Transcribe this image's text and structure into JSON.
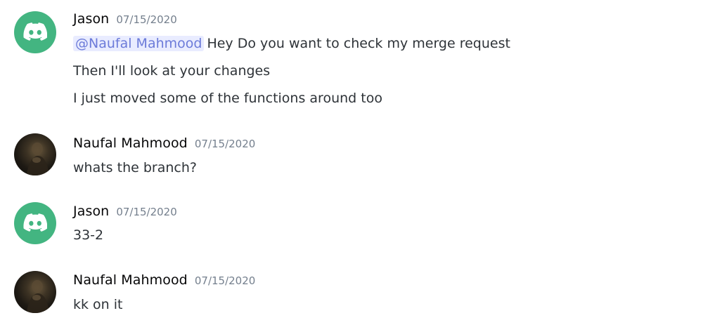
{
  "messages": [
    {
      "author": "Jason",
      "timestamp": "07/15/2020",
      "avatar": "discord-default-avatar",
      "avatar_color": "#43b581",
      "lines": [
        {
          "mention": "@Naufal Mahmood",
          "text": "Hey Do you want to check my merge request"
        },
        {
          "text": "Then I'll look at your changes"
        },
        {
          "text": "I just moved some of the functions around too"
        }
      ]
    },
    {
      "author": "Naufal Mahmood",
      "timestamp": "07/15/2020",
      "avatar": "user-photo-avatar",
      "lines": [
        {
          "text": "whats the branch?"
        }
      ]
    },
    {
      "author": "Jason",
      "timestamp": "07/15/2020",
      "avatar": "discord-default-avatar",
      "avatar_color": "#43b581",
      "lines": [
        {
          "text": "33-2"
        }
      ]
    },
    {
      "author": "Naufal Mahmood",
      "timestamp": "07/15/2020",
      "avatar": "user-photo-avatar",
      "lines": [
        {
          "text": "kk on it"
        }
      ]
    }
  ]
}
